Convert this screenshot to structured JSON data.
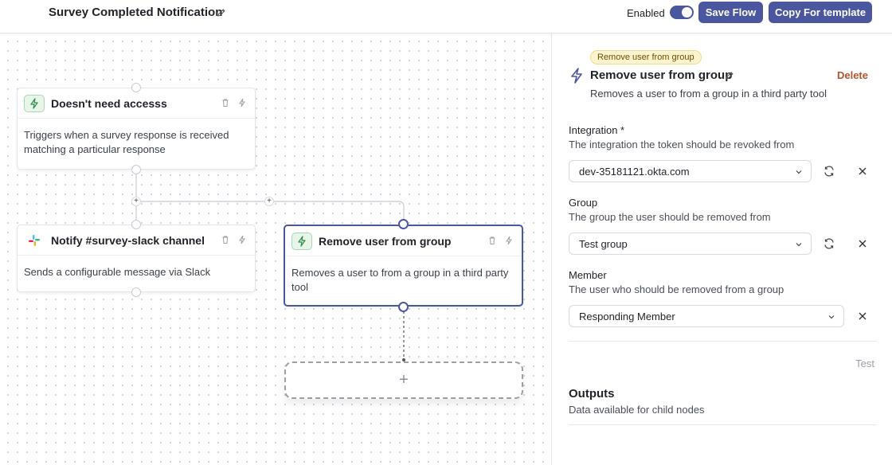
{
  "header": {
    "title": "Survey Completed Notification",
    "enabled_label": "Enabled",
    "enabled": true,
    "save_label": "Save Flow",
    "copy_label": "Copy For template"
  },
  "canvas": {
    "nodes": [
      {
        "title": "Doesn't need accesss",
        "icon": "lightning-icon",
        "description": "Triggers when a survey response is received matching a particular response"
      },
      {
        "title": "Notify #survey-slack channel",
        "icon": "slack-icon",
        "description": "Sends a configurable message via Slack"
      },
      {
        "title": "Remove user from group",
        "icon": "lightning-icon",
        "description": "Removes a user to from a group in a third party tool",
        "selected": true
      }
    ],
    "add_node_symbol": "+",
    "branch_plus_symbol": "+"
  },
  "panel": {
    "badge": "Remove user from group",
    "title": "Remove user from group",
    "delete_label": "Delete",
    "description": "Removes a user to from a group in a third party tool",
    "fields": [
      {
        "label": "Integration *",
        "help": "The integration the token should be revoked from",
        "value": "dev-35181121.okta.com"
      },
      {
        "label": "Group",
        "help": "The group the user should be removed from",
        "value": "Test group"
      },
      {
        "label": "Member",
        "help": "The user who should be removed from a group",
        "value": "Responding Member"
      }
    ],
    "test_label": "Test",
    "outputs_title": "Outputs",
    "outputs_help": "Data available for child nodes"
  },
  "colors": {
    "accent": "#4a569d",
    "delete": "#b2542a",
    "badge_bg": "#fdf3cf",
    "trigger_icon_bg": "#e7f6e9"
  }
}
